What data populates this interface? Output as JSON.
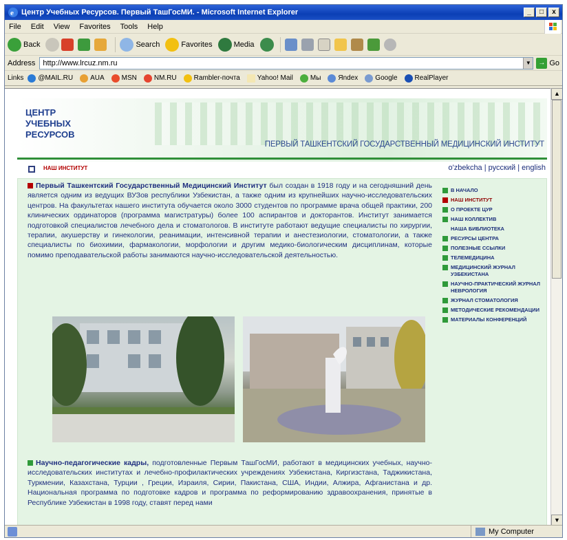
{
  "window": {
    "title": "Центр Учебных Ресурсов. Первый ТашГосМИ. - Microsoft Internet Explorer",
    "controls": [
      "_",
      "□",
      "x"
    ]
  },
  "menu": [
    "File",
    "Edit",
    "View",
    "Favorites",
    "Tools",
    "Help"
  ],
  "toolbar": {
    "back": "Back",
    "search": "Search",
    "favorites": "Favorites",
    "media": "Media"
  },
  "address": {
    "label": "Address",
    "url": "http://www.lrcuz.nm.ru",
    "go": "Go"
  },
  "links": {
    "label": "Links",
    "items": [
      "@MAIL.RU",
      "AUA",
      "MSN",
      "NM.RU",
      "Rambler-почта",
      "Yahoo! Mail",
      "Мы",
      "Яndex",
      "Google",
      "RealPlayer"
    ]
  },
  "header": {
    "logo_line1": "ЦЕНТР",
    "logo_line2": "УЧЕБНЫХ",
    "logo_line3": "РЕСУРСОВ",
    "subtitle": "ПЕРВЫЙ ТАШКЕНТСКИЙ ГОСУДАРСТВЕННЫЙ МЕДИЦИНСКИЙ ИНСТИТУТ"
  },
  "subnav": {
    "crumb": "НАШ ИНСТИТУТ",
    "lang_uz": "o'zbekcha",
    "lang_sep": "|",
    "lang_ru": "русский",
    "lang_en": "english"
  },
  "main": {
    "intro_bold": "Первый Ташкентский Государственный Медицинский Институт",
    "intro_text": " был создан в 1918 году и на сегодняшний день является одним из ведущих ВУЗов республики Узбекистан, а также одним из крупнейших научно-исследовательских центров. На факультетах нашего института обучается около 3000 студентов по программе врача общей практики, 200 клинических ординаторов (программа магистратуры) более 100 аспирантов и докторантов. Институт занимается подготовкой специалистов лечебного дела и стоматологов. В институте работают ведущие специалисты по хирургии, терапии, акушерству и гинекологии, реанимации, интенсивной терапии и анестезиологии, стоматологии, а также специалисты по биохимии, фармакологии, морфологии и другим медико-биологическим дисциплинам, которые помимо преподавательской работы занимаются научно-исследовательской деятельностью.",
    "second_bold": "Научно-педагогические кадры,",
    "second_text": " подготовленные Первым ТашГосМИ, работают в медицинских учебных, научно-исследовательских институтах и лечебно-профилактических учреждениях Узбекистана, Киргизстана, Таджикистана, Туркмении, Казахстана, Турции , Греции, Израиля, Сирии, Пакистана, США, Индии, Алжира, Афганистана и др. Национальная программа по подготовке кадров и программа по реформированию здравоохранения, принятые в Республике Узбекистан в 1998 году, ставят перед нами"
  },
  "sidenav": [
    {
      "label": "В НАЧАЛО",
      "color": "green"
    },
    {
      "label": "НАШ ИНСТИТУТ",
      "color": "red"
    },
    {
      "label": "О ПРОЕКТЕ ЦУР",
      "color": "green"
    },
    {
      "label": "НАШ КОЛЛЕКТИВ",
      "color": "green"
    },
    {
      "label": "НАША БИБЛИОТЕКА",
      "color": "none"
    },
    {
      "label": "РЕСУРСЫ ЦЕНТРА",
      "color": "green"
    },
    {
      "label": "ПОЛЕЗНЫЕ ССЫЛКИ",
      "color": "green"
    },
    {
      "label": "ТЕЛЕМЕДИЦИНА",
      "color": "green"
    },
    {
      "label": "МЕДИЦИНСКИЙ ЖУРНАЛ УЗБЕКИСТАНА",
      "color": "green"
    },
    {
      "label": "НАУЧНО-ПРАКТИЧЕСКИЙ ЖУРНАЛ НЕВРОЛОГИЯ",
      "color": "green"
    },
    {
      "label": "ЖУРНАЛ СТОМАТОЛОГИЯ",
      "color": "green"
    },
    {
      "label": "МЕТОДИЧЕСКИЕ РЕКОМЕНДАЦИИ",
      "color": "green"
    },
    {
      "label": "МАТЕРИАЛЫ КОНФЕРЕНЦИЙ",
      "color": "green"
    }
  ],
  "status": {
    "zone": "My Computer"
  },
  "colors": {
    "accent_green": "#2f8f38",
    "text_blue": "#1f2f7f",
    "active_red": "#b30000",
    "panel_bg": "#e4f4e4"
  }
}
